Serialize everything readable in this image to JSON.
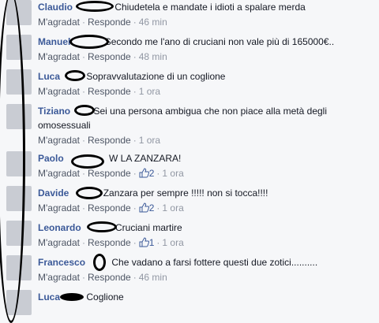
{
  "comments": [
    {
      "author": "Claudio",
      "text": "Chiudetela e mandate i idioti a spalare merda",
      "like": "M'agradat",
      "reply": "Responde",
      "likes": "",
      "time": "46 min"
    },
    {
      "author": "Manuel",
      "text": "Secondo me l'ano di cruciani non vale più di 165000€..",
      "like": "M'agradat",
      "reply": "Responde",
      "likes": "",
      "time": "48 min"
    },
    {
      "author": "Luca",
      "text": "Sopravvalutazione di un coglione",
      "like": "M'agradat",
      "reply": "Responde",
      "likes": "",
      "time": "1 ora"
    },
    {
      "author": "Tiziano",
      "text": "Sei una persona ambigua che non piace alla metà degli omosessuali",
      "like": "M'agradat",
      "reply": "Responde",
      "likes": "",
      "time": "1 ora"
    },
    {
      "author": "Paolo",
      "text": "W LA ZANZARA!",
      "like": "M'agradat",
      "reply": "Responde",
      "likes": "2",
      "time": "1 ora"
    },
    {
      "author": "Davide",
      "text": "Zanzara per sempre !!!!! non si tocca!!!!",
      "like": "M'agradat",
      "reply": "Responde",
      "likes": "2",
      "time": "1 ora"
    },
    {
      "author": "Leonardo",
      "text": "Cruciani martire",
      "like": "M'agradat",
      "reply": "Responde",
      "likes": "1",
      "time": "1 ora"
    },
    {
      "author": "Francesco",
      "text": "Che vadano a farsi fottere questi due zotici..........",
      "like": "M'agradat",
      "reply": "Responde",
      "likes": "",
      "time": "46 min"
    },
    {
      "author": "Luca",
      "text": "Coglione",
      "like": "",
      "reply": "",
      "likes": "",
      "time": ""
    }
  ],
  "separator": "·",
  "colors": {
    "author": "#3b5998",
    "background": "#f6f7f9",
    "meta": "#9197a3"
  }
}
